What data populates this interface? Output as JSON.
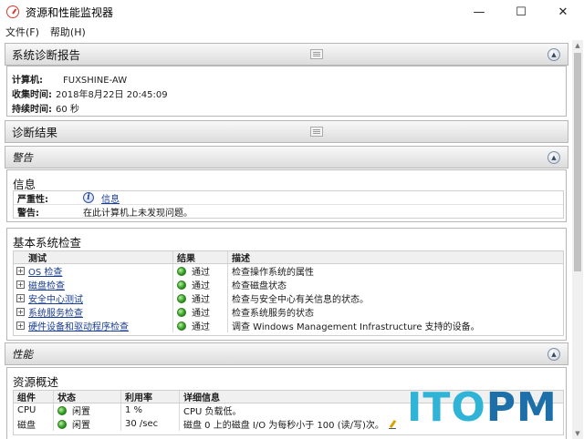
{
  "window": {
    "title": "资源和性能监视器",
    "menus": [
      "文件(F)",
      "帮助(H)"
    ]
  },
  "sections": {
    "report": {
      "title": "系统诊断报告"
    },
    "results": {
      "title": "诊断结果"
    },
    "warning": {
      "title": "警告"
    },
    "performance": {
      "title": "性能"
    }
  },
  "report_info": [
    {
      "key": "计算机:",
      "value": "FUXSHINE-AW"
    },
    {
      "key": "收集时间:",
      "value": "2018年8月22日  20:45:09"
    },
    {
      "key": "持续时间:",
      "value": "60 秒"
    }
  ],
  "info_box": {
    "title": "信息",
    "severity_key": "严重性:",
    "severity_value": "信息",
    "warning_key": "警告:",
    "warning_value": "在此计算机上未发现问题。"
  },
  "basic_checks": {
    "title": "基本系统检查",
    "headers": [
      "测试",
      "结果",
      "描述"
    ],
    "rows": [
      {
        "test": "OS 检查",
        "result": "通过",
        "desc": "检查操作系统的属性"
      },
      {
        "test": "磁盘检查",
        "result": "通过",
        "desc": "检查磁盘状态"
      },
      {
        "test": "安全中心测试",
        "result": "通过",
        "desc": "检查与安全中心有关信息的状态。"
      },
      {
        "test": "系统服务检查",
        "result": "通过",
        "desc": "检查系统服务的状态"
      },
      {
        "test": "硬件设备和驱动程序检查",
        "result": "通过",
        "desc": "调查  Windows Management Infrastructure 支持的设备。"
      }
    ]
  },
  "resource_overview": {
    "title": "资源概述",
    "headers": [
      "组件",
      "状态",
      "利用率",
      "详细信息"
    ],
    "rows": [
      {
        "component": "CPU",
        "status": "闲置",
        "usage": "1 %",
        "detail": "CPU 负载低。"
      },
      {
        "component": "磁盘",
        "status": "闲置",
        "usage": "30 /sec",
        "detail": "磁盘  0 上的磁盘  I/O 为每秒小于  100 (读/写)次。"
      }
    ]
  },
  "watermark": {
    "text_a": "ITO",
    "text_b": "PM"
  },
  "colors": {
    "link": "#1b3e8f",
    "status_ok": "#2f9a20",
    "watermark_light": "#2fb3d6",
    "watermark_dark": "#1c6fa8"
  }
}
